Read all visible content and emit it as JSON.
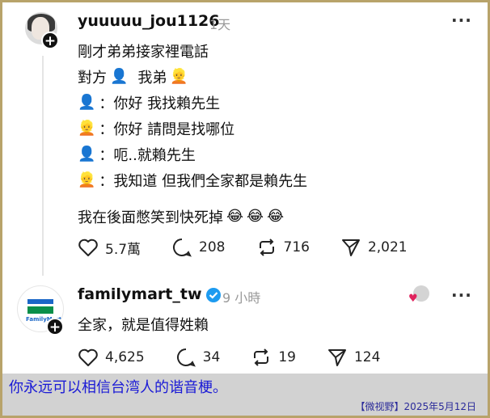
{
  "post1": {
    "username": "yuuuuu_jou1126",
    "time": "1天",
    "lines": [
      "剛才弟弟接家裡電話",
      "對方",
      "我弟",
      "：你好 我找賴先生",
      "：你好 請問是找哪位",
      "：呃..就賴先生",
      "：我知道 但我們全家都是賴先生",
      "我在後面憋笑到快死掉"
    ],
    "emoji": {
      "person": "👤",
      "boy": "👱",
      "laugh": "😂"
    },
    "actions": {
      "likes": "5.7萬",
      "comments": "208",
      "reposts": "716",
      "shares": "2,021"
    }
  },
  "post2": {
    "username": "familymart_tw",
    "time": "9 小時",
    "text": "全家，就是值得姓賴",
    "actions": {
      "likes": "4,625",
      "comments": "34",
      "reposts": "19",
      "shares": "124"
    },
    "brand_colors": {
      "green": "#0a8f4a",
      "blue": "#1b67c7"
    }
  },
  "caption": "你永远可以相信台湾人的谐音梗。",
  "credit": "【微视野】2025年5月12日"
}
